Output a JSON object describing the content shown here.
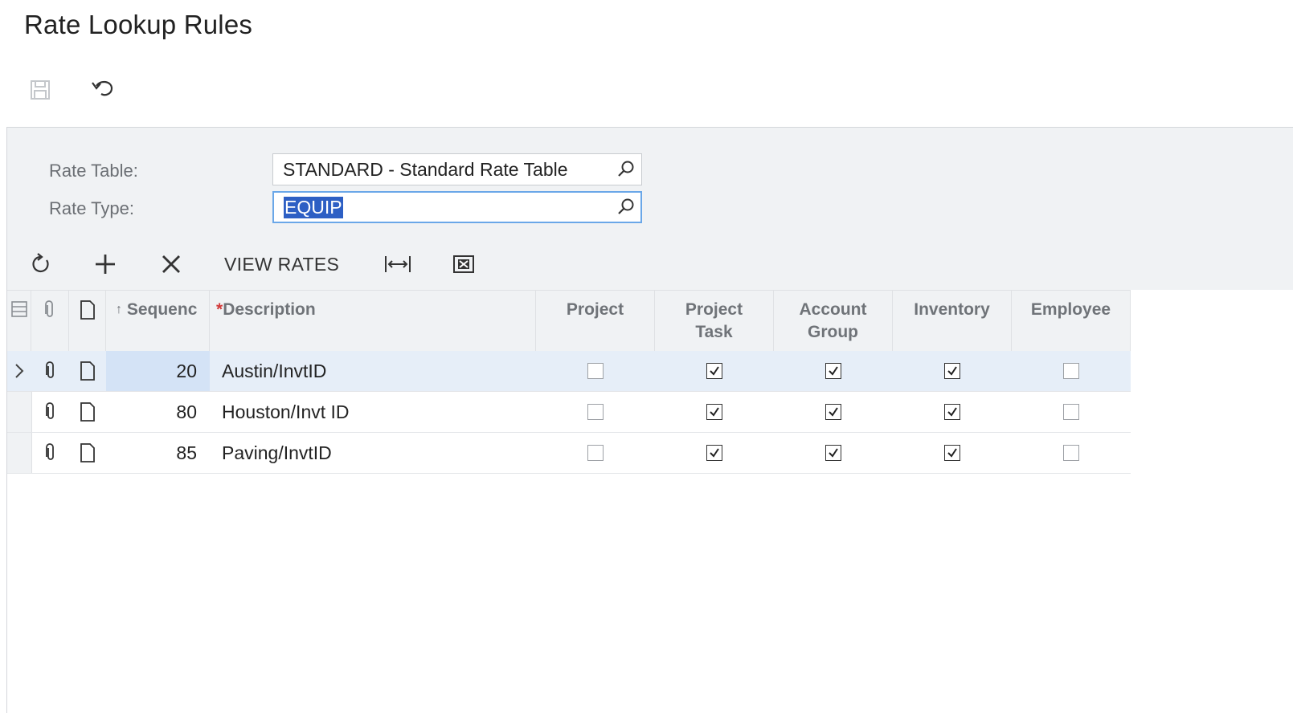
{
  "page": {
    "title": "Rate Lookup Rules"
  },
  "toolbar": {
    "save_icon": "save-icon",
    "undo_icon": "undo-icon"
  },
  "form": {
    "rate_table": {
      "label": "Rate Table:",
      "value": "STANDARD - Standard Rate Table"
    },
    "rate_type": {
      "label": "Rate Type:",
      "value": "EQUIP"
    }
  },
  "grid_toolbar": {
    "refresh_icon": "refresh-icon",
    "add_icon": "plus-icon",
    "delete_icon": "close-icon",
    "view_rates_label": "VIEW RATES",
    "fit_icon": "fit-to-screen-icon",
    "export_icon": "export-excel-icon"
  },
  "grid": {
    "columns": {
      "sequence": "Sequenc",
      "description_required": "*",
      "description": "Description",
      "project": "Project",
      "project_task_1": "Project",
      "project_task_2": "Task",
      "account_group_1": "Account",
      "account_group_2": "Group",
      "inventory": "Inventory",
      "employee": "Employee"
    },
    "rows": [
      {
        "sequence": "20",
        "description": "Austin/InvtID",
        "project": false,
        "project_task": true,
        "account_group": true,
        "inventory": true,
        "employee": false,
        "active": true
      },
      {
        "sequence": "80",
        "description": "Houston/Invt ID",
        "project": false,
        "project_task": true,
        "account_group": true,
        "inventory": true,
        "employee": false,
        "active": false
      },
      {
        "sequence": "85",
        "description": "Paving/InvtID",
        "project": false,
        "project_task": true,
        "account_group": true,
        "inventory": true,
        "employee": false,
        "active": false
      }
    ]
  },
  "colors": {
    "selection": "#2d5fc4",
    "focus_border": "#6aa7e8",
    "active_row": "#e6eef8",
    "header_bg": "#f0f2f4"
  }
}
